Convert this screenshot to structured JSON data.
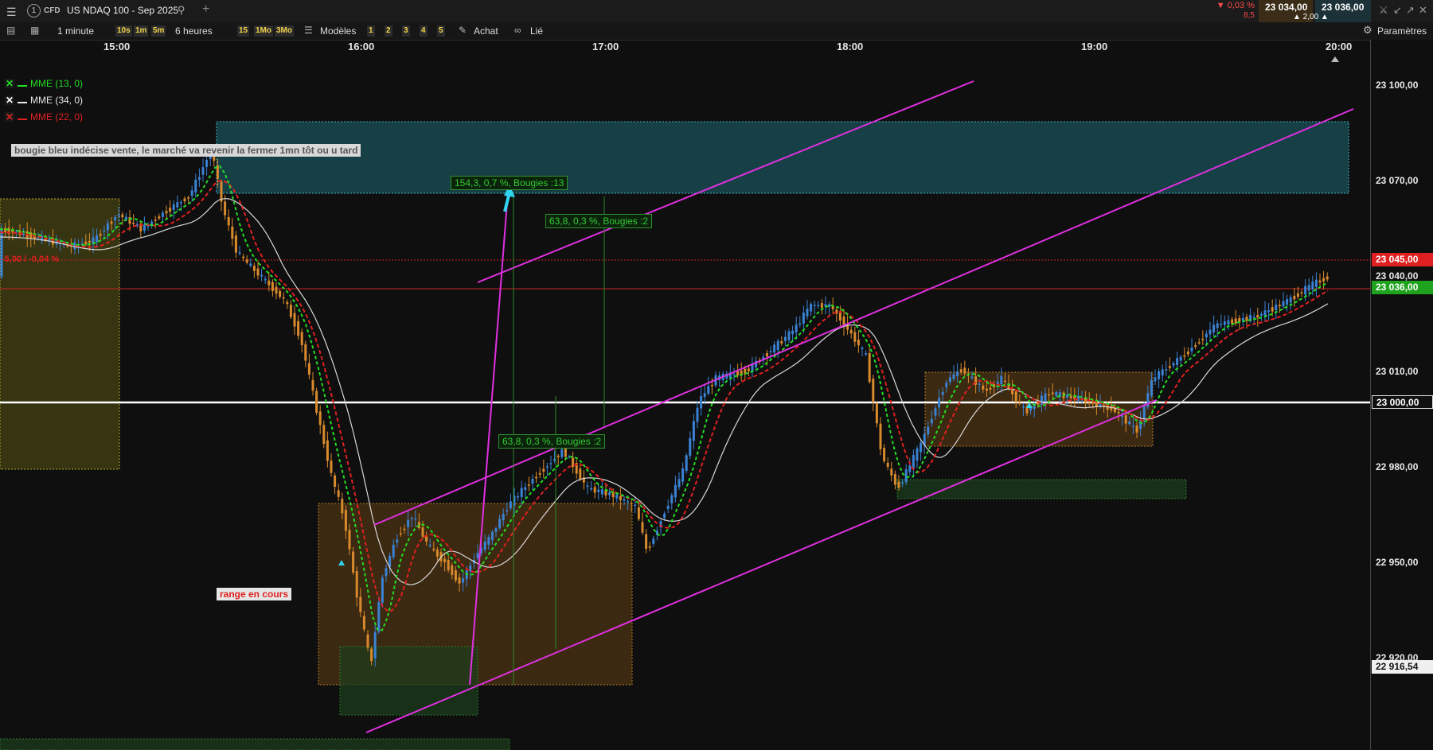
{
  "toolbar": {
    "menu_icon": "menu-icon",
    "account_number": "1",
    "instrument_type": "CFD",
    "symbol": "US NDAQ 100 - Sep 2025",
    "add_tab": "+",
    "change_pct": "▼ 0,03 %",
    "change_pts": "8,5",
    "bid": "23 034,00",
    "ask": "23 036,00",
    "spread": "▲ 2,00 ▲"
  },
  "toolbar2": {
    "interval": "1 minute",
    "quick_intervals": [
      "10s",
      "1m",
      "5m"
    ],
    "range": "6 heures",
    "quick_ranges": [
      "15",
      "1Mo",
      "3Mo"
    ],
    "models": "Modèles",
    "model_slots": [
      "1",
      "2",
      "3",
      "4",
      "5"
    ],
    "buy": "Achat",
    "linked": "Lié",
    "settings": "Paramètres"
  },
  "chart_data": {
    "type": "candlestick",
    "time_labels": [
      "15:00",
      "16:00",
      "17:00",
      "18:00",
      "19:00",
      "20:00"
    ],
    "y_ticks": [
      "23 100,00",
      "23 070,00",
      "23 040,00",
      "23 010,00",
      "22 980,00",
      "22 950,00",
      "22 920,00"
    ],
    "y_range": [
      22890,
      23110
    ],
    "price_tags": {
      "resistance": "23 045,00",
      "last": "23 036,00",
      "level": "23 000,00",
      "low": "22 916,54"
    },
    "legend": [
      {
        "label": "MME (13, 0)",
        "color": "#22dd22",
        "visible": true
      },
      {
        "label": "MME (34, 0)",
        "color": "#e6e6e6",
        "visible": true
      },
      {
        "label": "MME (22, 0)",
        "color": "#e02020",
        "visible": false
      }
    ],
    "annotations": {
      "comment": "bougie bleu indécise vente, le marché va revenir la fermer 1mn tôt ou u tard",
      "range": "range en cours",
      "left_price": "-5,00 / -0,04 %",
      "measure1": "154,3, 0,7 %, Bougies :13",
      "measure2": "63,8, 0,3 %, Bougies :2",
      "measure3": "63,8, 0,3 %, Bougies :2"
    },
    "colors": {
      "up_candle": "#3a82d4",
      "down_candle": "#d98a2c",
      "channel": "#e030e0",
      "zone_blue": "#1c5f6a",
      "zone_orange": "#5a3a12",
      "zone_yellow": "#5a5316",
      "zone_green": "#1d3d1d"
    }
  }
}
